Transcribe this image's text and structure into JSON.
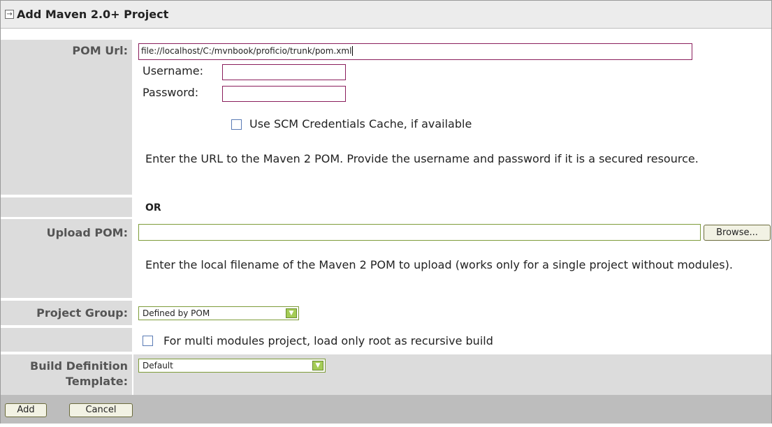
{
  "title": "Add Maven 2.0+ Project",
  "pom_url": {
    "label": "POM Url:",
    "value": "file://localhost/C:/mvnbook/proficio/trunk/pom.xml",
    "username_label": "Username:",
    "password_label": "Password:",
    "scm_cache_label": "Use SCM Credentials Cache, if available",
    "help": "Enter the URL to the Maven 2 POM. Provide the username and password if it is a secured resource."
  },
  "or_label": "OR",
  "upload_pom": {
    "label": "Upload POM:",
    "browse_label": "Browse...",
    "help": "Enter the local filename of the Maven 2 POM to upload (works only for a single project without modules)."
  },
  "project_group": {
    "label": "Project Group:",
    "selected": "Defined by POM"
  },
  "multi_module_label": "For multi modules project, load only root as recursive build",
  "build_template": {
    "label_line1": "Build Definition",
    "label_line2": "Template:",
    "selected": "Default"
  },
  "buttons": {
    "add": "Add",
    "cancel": "Cancel"
  },
  "icons": {
    "title": "collapse-arrow-icon",
    "select": "chevron-down-icon"
  },
  "colors": {
    "label_bg": "#dcdcdc",
    "input_border_active": "#8a1e5c",
    "input_border": "#7e9c3a",
    "select_arrow": "#a4cc56",
    "footer_bg": "#bdbdbd"
  }
}
